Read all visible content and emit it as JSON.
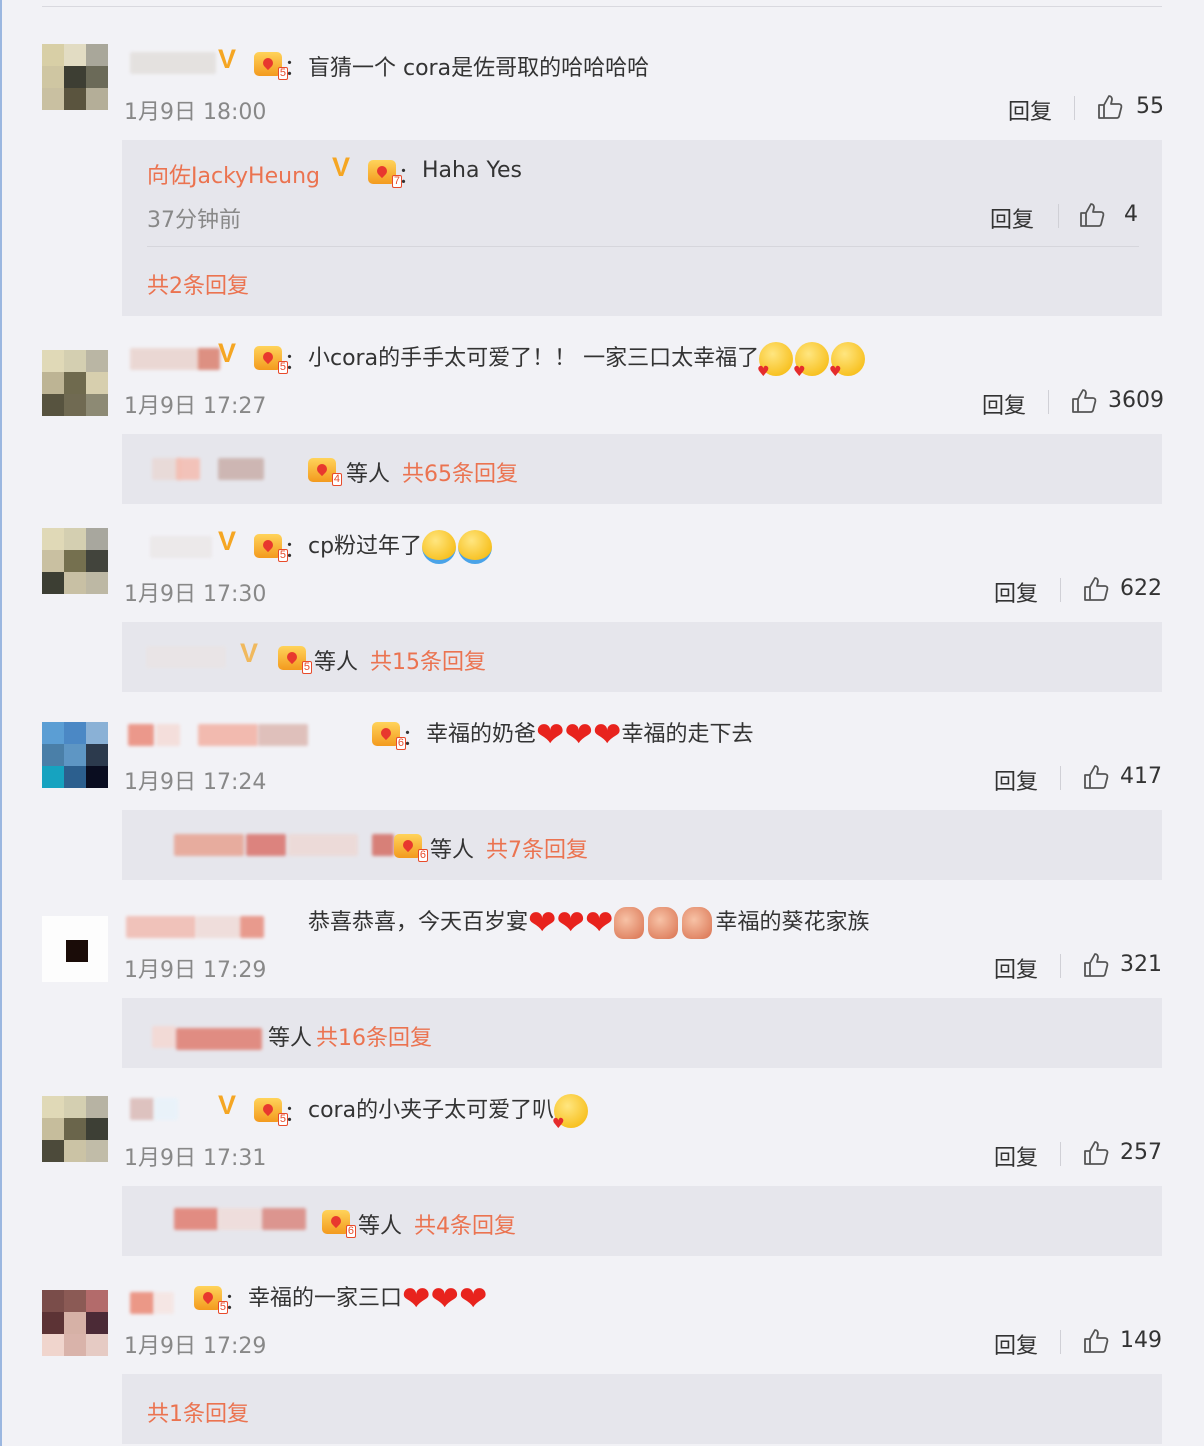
{
  "labels": {
    "reply": "回复"
  },
  "comments": [
    {
      "text": "盲猜一个 cora是佐哥取的哈哈哈哈",
      "time": "1月9日 18:00",
      "likes": "55",
      "sub": {
        "reply_user": "向佐JackyHeung",
        "reply_text": "Haha Yes",
        "reply_time": "37分钟前",
        "reply_likes": "4",
        "summary": "共2条回复"
      }
    },
    {
      "text": "小cora的手手太可爱了！！ 一家三口太幸福了",
      "time": "1月9日 17:27",
      "likes": "3609",
      "sub": {
        "etc": "等人",
        "summary": "共65条回复"
      }
    },
    {
      "text": "cp粉过年了",
      "time": "1月9日 17:30",
      "likes": "622",
      "sub": {
        "etc": "等人",
        "summary": "共15条回复"
      }
    },
    {
      "text_a": "幸福的奶爸",
      "text_b": "幸福的走下去",
      "time": "1月9日 17:24",
      "likes": "417",
      "sub": {
        "etc": "等人",
        "summary": "共7条回复"
      }
    },
    {
      "text_a": "恭喜恭喜，今天百岁宴",
      "text_b": "幸福的葵花家族",
      "time": "1月9日 17:29",
      "likes": "321",
      "sub": {
        "etc": "等人",
        "summary": "共16条回复"
      }
    },
    {
      "text": "cora的小夹子太可爱了叭",
      "time": "1月9日 17:31",
      "likes": "257",
      "sub": {
        "etc": "等人",
        "summary": "共4条回复"
      }
    },
    {
      "text": "幸福的一家三口",
      "time": "1月9日 17:29",
      "likes": "149",
      "sub": {
        "summary": "共1条回复"
      }
    }
  ],
  "colors": {
    "link": "#eb7350",
    "badge_v": "#f5a623",
    "heart": "#e8231d"
  },
  "icons": {
    "like": "thumbs-up-icon",
    "vip": "vip-crown-icon",
    "verified": "verified-v-icon"
  }
}
